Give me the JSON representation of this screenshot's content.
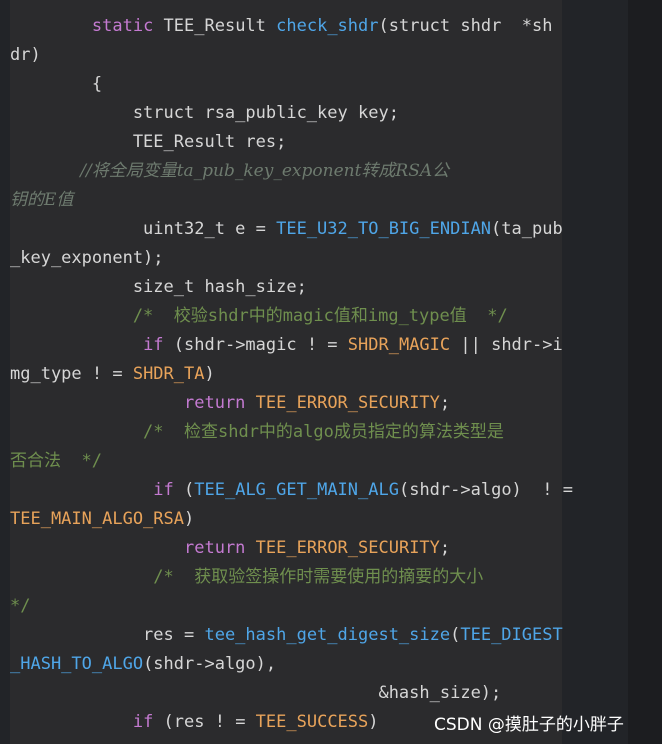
{
  "code_lines": [
    [
      {
        "t": "        ",
        "c": ""
      },
      {
        "t": "static",
        "c": "kw"
      },
      {
        "t": " TEE_Result ",
        "c": ""
      },
      {
        "t": "check_shdr",
        "c": "fn"
      },
      {
        "t": "(struct shdr  *sh",
        "c": ""
      }
    ],
    [
      {
        "t": "dr)",
        "c": ""
      }
    ],
    [
      {
        "t": "        {",
        "c": ""
      }
    ],
    [
      {
        "t": "            struct rsa_public_key key;",
        "c": ""
      }
    ],
    [
      {
        "t": "            TEE_Result res;",
        "c": ""
      }
    ],
    [
      {
        "t": "             //将全局变量ta_pub_key_exponent转成RSA公",
        "c": "cm"
      }
    ],
    [
      {
        "t": "钥的E值",
        "c": "cm"
      }
    ],
    [
      {
        "t": "             uint32_t e = ",
        "c": ""
      },
      {
        "t": "TEE_U32_TO_BIG_ENDIAN",
        "c": "fn"
      },
      {
        "t": "(ta_pub",
        "c": ""
      }
    ],
    [
      {
        "t": "_key_exponent);",
        "c": ""
      }
    ],
    [
      {
        "t": "            size_t hash_size;",
        "c": ""
      }
    ],
    [
      {
        "t": "            /*  校验shdr中的magic值和img_type值  */",
        "c": "cm2"
      }
    ],
    [
      {
        "t": "             ",
        "c": ""
      },
      {
        "t": "if",
        "c": "kw"
      },
      {
        "t": " (shdr->magic ! = ",
        "c": ""
      },
      {
        "t": "SHDR_MAGIC",
        "c": "mac"
      },
      {
        "t": " || shdr->i",
        "c": ""
      }
    ],
    [
      {
        "t": "mg_type ! = ",
        "c": ""
      },
      {
        "t": "SHDR_TA",
        "c": "mac"
      },
      {
        "t": ")",
        "c": ""
      }
    ],
    [
      {
        "t": "                 ",
        "c": ""
      },
      {
        "t": "return",
        "c": "kw"
      },
      {
        "t": " ",
        "c": ""
      },
      {
        "t": "TEE_ERROR_SECURITY",
        "c": "mac"
      },
      {
        "t": ";",
        "c": ""
      }
    ],
    [
      {
        "t": "             /*  检查shdr中的algo成员指定的算法类型是",
        "c": "cm2"
      }
    ],
    [
      {
        "t": "否合法  */",
        "c": "cm2"
      }
    ],
    [
      {
        "t": "              ",
        "c": ""
      },
      {
        "t": "if",
        "c": "kw"
      },
      {
        "t": " (",
        "c": ""
      },
      {
        "t": "TEE_ALG_GET_MAIN_ALG",
        "c": "fn"
      },
      {
        "t": "(shdr->algo)  ! =",
        "c": ""
      }
    ],
    [
      {
        "t": "TEE_MAIN_ALGO_RSA",
        "c": "mac"
      },
      {
        "t": ")",
        "c": ""
      }
    ],
    [
      {
        "t": "                 ",
        "c": ""
      },
      {
        "t": "return",
        "c": "kw"
      },
      {
        "t": " ",
        "c": ""
      },
      {
        "t": "TEE_ERROR_SECURITY",
        "c": "mac"
      },
      {
        "t": ";",
        "c": ""
      }
    ],
    [
      {
        "t": "              /*  获取验签操作时需要使用的摘要的大小",
        "c": "cm2"
      }
    ],
    [
      {
        "t": "*/",
        "c": "cm2"
      }
    ],
    [
      {
        "t": "             res = ",
        "c": ""
      },
      {
        "t": "tee_hash_get_digest_size",
        "c": "fn"
      },
      {
        "t": "(",
        "c": ""
      },
      {
        "t": "TEE_DIGEST",
        "c": "fn"
      }
    ],
    [
      {
        "t": "_HASH_TO_ALGO",
        "c": "fn"
      },
      {
        "t": "(shdr->algo),",
        "c": ""
      }
    ],
    [
      {
        "t": "                                    &hash_size);",
        "c": ""
      }
    ],
    [
      {
        "t": "            ",
        "c": ""
      },
      {
        "t": "if",
        "c": "kw"
      },
      {
        "t": " (res ! = ",
        "c": ""
      },
      {
        "t": "TEE_SUCCESS",
        "c": "mac"
      },
      {
        "t": ")",
        "c": ""
      }
    ]
  ],
  "watermark": "CSDN @摸肚子的小胖子",
  "colors": {
    "background": "#222428",
    "panel": "#2b2b2d",
    "keyword": "#c47ad1",
    "function": "#4fa6e8",
    "macro": "#e8a35a",
    "comment": "#6f8f4e",
    "text": "#d6d6d6"
  }
}
